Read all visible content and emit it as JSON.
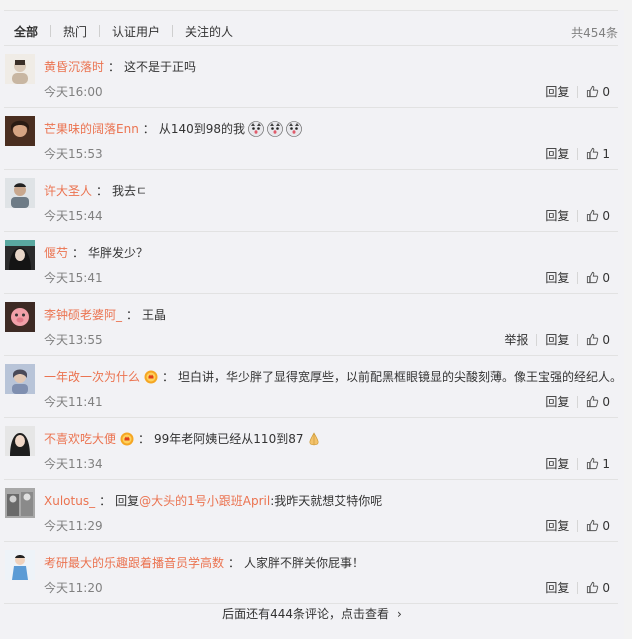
{
  "tabs": [
    "全部",
    "热门",
    "认证用户",
    "关注的人"
  ],
  "total": "共454条",
  "actions": {
    "reply": "回复",
    "report": "举报"
  },
  "comments": [
    {
      "name": "黄昏沉落时",
      "text": "这不是于正吗",
      "time": "今天16:00",
      "likes": "0",
      "avatar_color": "#d9c9b8"
    },
    {
      "name": "芒果味的阔落Enn",
      "text": "从140到98的我",
      "time": "今天15:53",
      "likes": "1",
      "avatar_color": "#8a5a3c"
    },
    {
      "name": "许大圣人",
      "text": "我去ㄷ",
      "time": "今天15:44",
      "likes": "0",
      "avatar_color": "#6e7b86"
    },
    {
      "name": "偃芍",
      "text": "华胖发少？",
      "time": "今天15:41",
      "likes": "0",
      "avatar_color": "#3a3a3a"
    },
    {
      "name": "李钟硕老婆阿_",
      "text": "王晶",
      "time": "今天13:55",
      "likes": "0",
      "avatar_color": "#b87a64"
    },
    {
      "name": "一年改一次为什么",
      "text": "坦白讲，华少胖了显得宽厚些，以前配黑框眼镜显的尖酸刻薄。像王宝强的经纪人。",
      "time": "今天11:41",
      "likes": "0",
      "avatar_color": "#7f8fb0"
    },
    {
      "name": "不喜欢吃大便",
      "text": "99年老阿姨已经从110到87",
      "time": "今天11:34",
      "likes": "1",
      "avatar_color": "#2e2e2e"
    },
    {
      "name": "Xulotus_",
      "reply_prefix": "回复",
      "mention": "@大头的1号小跟班April",
      "text": ":我昨天就想艾特你呢",
      "time": "今天11:29",
      "likes": "0",
      "avatar_color": "#8a8a8a"
    },
    {
      "name": "考研最大的乐趣跟着播音员学高数",
      "text": "人家胖不胖关你屁事！",
      "time": "今天11:20",
      "likes": "0",
      "avatar_color": "#5b9bd5"
    }
  ],
  "more": "后面还有444条评论，点击查看",
  "icons": {
    "like": "thumbs-up-icon",
    "more_chevron": "chevron-right-icon",
    "emoji_dog": "husky-emoji-icon",
    "emoji_pray": "praying-hands-emoji-icon",
    "badge": "medal-badge-icon"
  },
  "colors": {
    "name": "#eb7350",
    "time": "#808080",
    "divider": "#e2e2e2"
  }
}
